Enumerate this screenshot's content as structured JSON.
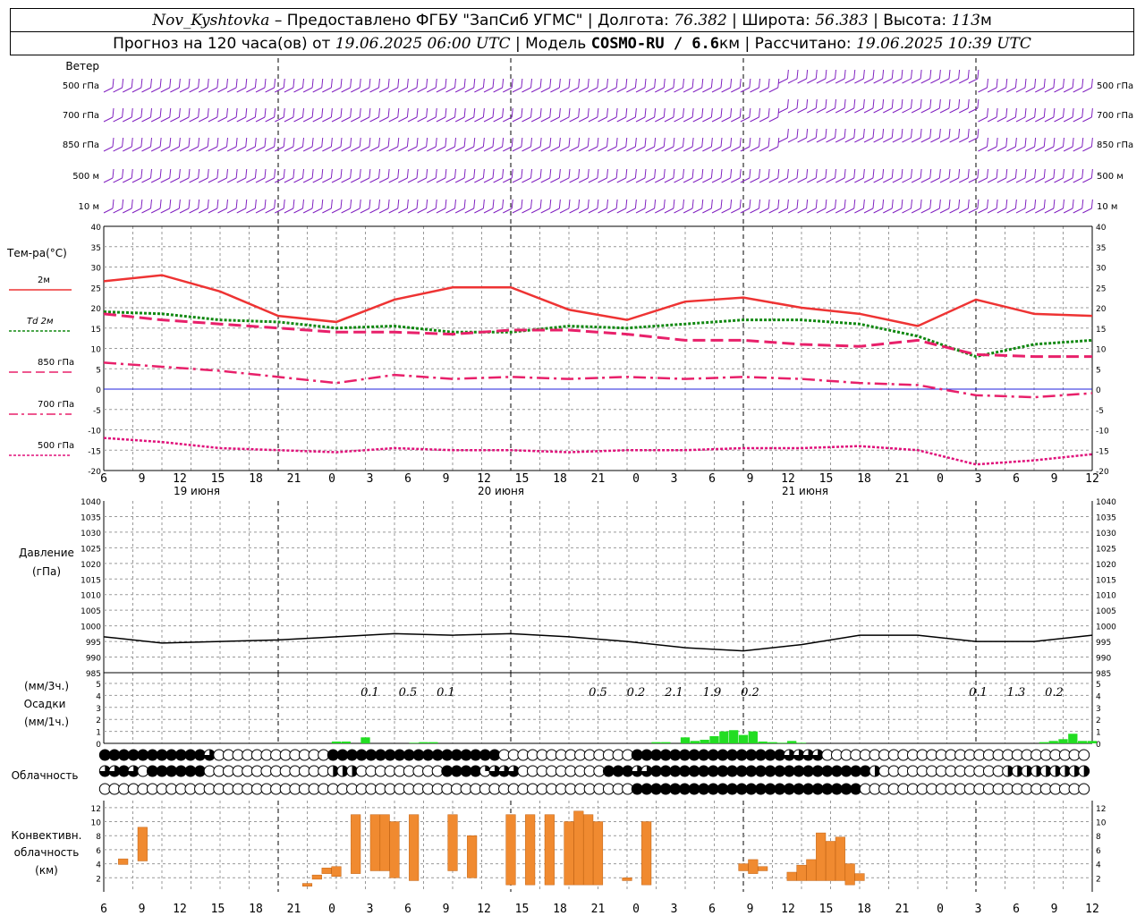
{
  "header": {
    "station": "Nov_Kyshtovka",
    "provider": " – Предоставлено ФГБУ \"ЗапСиб УГМС\" | Долгота: ",
    "lon": "76.382",
    "lat_label": " | Широта: ",
    "lat": "56.383",
    "alt_label": " | Высота: ",
    "alt": "113",
    "alt_unit": "м",
    "forecast_label": "Прогноз на 120 часа(ов) от ",
    "forecast_time": "19.06.2025 06:00 UTC",
    "model_label": " | Модель ",
    "model": "COSMO-RU / 6.6",
    "model_unit": "км",
    "calc_label": " | Рассчитано: ",
    "calc_time": "19.06.2025 10:39 UTC"
  },
  "labels": {
    "wind": "Ветер",
    "wind_levels": [
      "500 гПа",
      "700 гПа",
      "850 гПа",
      "500 м",
      "10 м"
    ],
    "temp": "Тем-ра(°C)",
    "legend": [
      "2м",
      "Td 2м",
      "850 гПа",
      "700 гПа",
      "500 гПа"
    ],
    "pressure": [
      "Давление",
      "(гПа)"
    ],
    "precip": [
      "(мм/3ч.)",
      "Осадки",
      "(мм/1ч.)"
    ],
    "cloud": "Облачность",
    "conv": [
      "Конвективн.",
      "облачность",
      "(км)"
    ],
    "dates": [
      "19 июня",
      "20 июня",
      "21 июня"
    ]
  },
  "colors": {
    "t2m": "#ee3333",
    "td": "#118811",
    "t850": "#e8206a",
    "t700": "#e8206a",
    "t500": "#e0107a",
    "wind": "#8020c0",
    "precip": "#22dd22",
    "conv": "#f08a30",
    "zero_line": "#2020dd"
  },
  "chart_data": {
    "type": "line",
    "x_hour_labels": [
      "6",
      "9",
      "12",
      "15",
      "18",
      "21",
      "0",
      "3",
      "6",
      "9",
      "12",
      "15",
      "18",
      "21",
      "0",
      "3",
      "6",
      "9",
      "12",
      "15",
      "18",
      "21",
      "0",
      "3",
      "6",
      "9",
      "12"
    ],
    "temperature": {
      "ylim": [
        -20,
        40
      ],
      "hours": [
        0,
        6,
        12,
        18,
        24,
        30,
        36,
        42,
        48,
        54,
        60,
        66,
        72,
        78,
        84,
        90,
        96,
        102
      ],
      "t2m": [
        26.5,
        28,
        24,
        18,
        16.5,
        22,
        25,
        25,
        19.5,
        17,
        21.5,
        22.5,
        20,
        18.5,
        15.5,
        22,
        18.5,
        18
      ],
      "td2m": [
        19,
        18.5,
        17,
        16.5,
        15,
        15.5,
        14,
        14,
        15.5,
        15,
        16,
        17,
        17,
        16,
        13,
        8,
        11,
        12
      ],
      "t850": [
        18.5,
        17,
        16,
        15,
        14,
        14,
        13.5,
        14.5,
        14.5,
        13.5,
        12,
        12,
        11,
        10.5,
        12,
        8.5,
        8,
        8
      ],
      "t700": [
        6.5,
        5.5,
        4.5,
        3,
        1.5,
        3.5,
        2.5,
        3,
        2.5,
        3,
        2.5,
        3,
        2.5,
        1.5,
        1,
        -1.5,
        -2,
        -1
      ],
      "t500": [
        -12,
        -13,
        -14.5,
        -15,
        -15.5,
        -14.5,
        -15,
        -15,
        -15.5,
        -15,
        -15,
        -14.5,
        -14.5,
        -14,
        -15,
        -18.5,
        -17.5,
        -16
      ]
    },
    "pressure": {
      "ylim": [
        985,
        1040
      ],
      "hours": [
        0,
        6,
        12,
        18,
        24,
        30,
        36,
        42,
        48,
        54,
        60,
        66,
        72,
        78,
        84,
        90,
        96,
        102
      ],
      "values": [
        996.5,
        994.5,
        995,
        995.5,
        996.5,
        997.5,
        997,
        997.5,
        996.5,
        995,
        993,
        992,
        994,
        997,
        997,
        995,
        995,
        997
      ]
    },
    "precipitation": {
      "ylim": [
        0,
        5
      ],
      "hours_1h": [
        24,
        25,
        27,
        32,
        33,
        34,
        57,
        58,
        60,
        61,
        62,
        63,
        64,
        65,
        66,
        67,
        68,
        69,
        70,
        71,
        72,
        97,
        98,
        99,
        100,
        101,
        102
      ],
      "values_1h": [
        0.15,
        0.15,
        0.5,
        0.05,
        0.1,
        0.1,
        0.1,
        0.1,
        0.5,
        0.2,
        0.3,
        0.6,
        1.0,
        1.1,
        0.7,
        1.0,
        0.15,
        0.1,
        0.05,
        0.2,
        0.05,
        0.1,
        0.2,
        0.35,
        0.8,
        0.2,
        0.2
      ],
      "labels_3h": [
        {
          "hour": 21,
          "text": "0.1"
        },
        {
          "hour": 24,
          "text": "0.5"
        },
        {
          "hour": 27,
          "text": "0.1"
        },
        {
          "hour": 39,
          "text": "0.5"
        },
        {
          "hour": 42,
          "text": "0.2"
        },
        {
          "hour": 45,
          "text": "2.1"
        },
        {
          "hour": 48,
          "text": "1.9"
        },
        {
          "hour": 51,
          "text": "0.2"
        },
        {
          "hour": 69,
          "text": "0.1"
        },
        {
          "hour": 72,
          "text": "1.3"
        },
        {
          "hour": 75,
          "text": "0.2"
        }
      ]
    },
    "convective_cloud": {
      "ylim": [
        0,
        13
      ],
      "bars": [
        {
          "h": 2,
          "base": 3.9,
          "top": 4.7
        },
        {
          "h": 4,
          "base": 4.4,
          "top": 9.2
        },
        {
          "h": 21,
          "base": 0.8,
          "top": 1.2
        },
        {
          "h": 22,
          "base": 1.8,
          "top": 2.4
        },
        {
          "h": 23,
          "base": 2.6,
          "top": 3.4
        },
        {
          "h": 24,
          "base": 2.2,
          "top": 3.6
        },
        {
          "h": 26,
          "base": 2.6,
          "top": 11
        },
        {
          "h": 28,
          "base": 3.0,
          "top": 11
        },
        {
          "h": 29,
          "base": 3.0,
          "top": 11
        },
        {
          "h": 30,
          "base": 2.0,
          "top": 10
        },
        {
          "h": 32,
          "base": 1.6,
          "top": 11
        },
        {
          "h": 36,
          "base": 3.0,
          "top": 11
        },
        {
          "h": 38,
          "base": 2.0,
          "top": 8.0
        },
        {
          "h": 42,
          "base": 1.0,
          "top": 11
        },
        {
          "h": 44,
          "base": 1.0,
          "top": 11
        },
        {
          "h": 46,
          "base": 1.0,
          "top": 11
        },
        {
          "h": 48,
          "base": 1.0,
          "top": 10
        },
        {
          "h": 49,
          "base": 1.0,
          "top": 11.5
        },
        {
          "h": 50,
          "base": 1.0,
          "top": 11
        },
        {
          "h": 51,
          "base": 1.0,
          "top": 10
        },
        {
          "h": 54,
          "base": 1.6,
          "top": 2.0
        },
        {
          "h": 56,
          "base": 1.0,
          "top": 10
        },
        {
          "h": 66,
          "base": 3.0,
          "top": 4.0
        },
        {
          "h": 67,
          "base": 2.6,
          "top": 4.6
        },
        {
          "h": 68,
          "base": 3.0,
          "top": 3.6
        },
        {
          "h": 71,
          "base": 1.6,
          "top": 2.8
        },
        {
          "h": 72,
          "base": 1.6,
          "top": 3.8
        },
        {
          "h": 73,
          "base": 1.6,
          "top": 4.6
        },
        {
          "h": 74,
          "base": 1.6,
          "top": 8.4
        },
        {
          "h": 75,
          "base": 1.6,
          "top": 7.2
        },
        {
          "h": 76,
          "base": 1.6,
          "top": 7.8
        },
        {
          "h": 77,
          "base": 1.0,
          "top": 4.0
        },
        {
          "h": 78,
          "base": 1.6,
          "top": 2.6
        }
      ]
    },
    "cloud_cover": {
      "rows": [
        "high",
        "middle",
        "low"
      ],
      "symbols": [
        "44444444444300000000000044444444444444444400000000000000444444444444444433330000000000000000000000000000",
        "33430444444000000000000022200000000044441333000000000444334444444444444444444444420000000000000222222222",
        "00000000000000000000000000000000000000000000000000000000444444444444444444444444000000000000000000000000"
      ]
    },
    "wind": {
      "levels": [
        "500 гПа",
        "700 гПа",
        "850 гПа",
        "500 м",
        "10 м"
      ],
      "direction": "west/south-west flow"
    }
  }
}
